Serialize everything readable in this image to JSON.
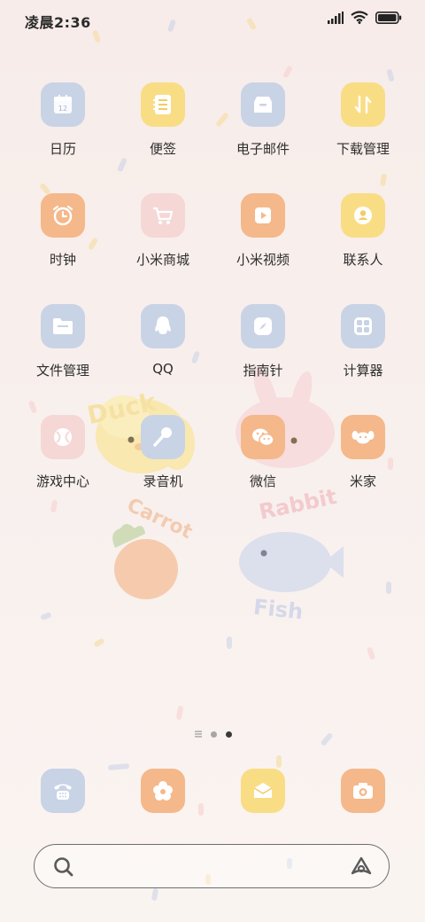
{
  "status_bar": {
    "time": "凌晨2:36"
  },
  "wallpaper": {
    "texts": [
      "Duck",
      "Rabbit",
      "Carrot",
      "Fish"
    ]
  },
  "apps": [
    {
      "label": "日历",
      "icon": "calendar-icon",
      "color": "#c9d3e6",
      "date": "12"
    },
    {
      "label": "便签",
      "icon": "notes-icon",
      "color": "#f9dd85"
    },
    {
      "label": "电子邮件",
      "icon": "email-inbox-icon",
      "color": "#c9d3e6"
    },
    {
      "label": "下载管理",
      "icon": "download-arrows-icon",
      "color": "#f9dd85"
    },
    {
      "label": "时钟",
      "icon": "alarm-clock-icon",
      "color": "#f4b88a"
    },
    {
      "label": "小米商城",
      "icon": "shopping-cart-icon",
      "color": "#f5d7d6"
    },
    {
      "label": "小米视频",
      "icon": "video-play-icon",
      "color": "#f4b88a"
    },
    {
      "label": "联系人",
      "icon": "contact-person-icon",
      "color": "#f9dd85"
    },
    {
      "label": "文件管理",
      "icon": "folder-icon",
      "color": "#c9d3e6"
    },
    {
      "label": "QQ",
      "icon": "penguin-icon",
      "color": "#c9d3e6"
    },
    {
      "label": "指南针",
      "icon": "compass-icon",
      "color": "#c9d3e6"
    },
    {
      "label": "计算器",
      "icon": "calculator-icon",
      "color": "#c9d3e6"
    },
    {
      "label": "游戏中心",
      "icon": "ball-icon",
      "color": "#f5d7d6"
    },
    {
      "label": "录音机",
      "icon": "microphone-icon",
      "color": "#c9d3e6"
    },
    {
      "label": "微信",
      "icon": "wechat-icon",
      "color": "#f4b88a"
    },
    {
      "label": "米家",
      "icon": "mijia-dog-icon",
      "color": "#f4b88a"
    }
  ],
  "dock": [
    {
      "icon": "phone-icon",
      "color": "#c9d3e6"
    },
    {
      "icon": "flower-gallery-icon",
      "color": "#f4b88a"
    },
    {
      "icon": "message-envelope-icon",
      "color": "#f9dd85"
    },
    {
      "icon": "camera-icon",
      "color": "#f4b88a"
    }
  ],
  "page_indicator": {
    "pages": 3,
    "current": 3
  },
  "search": {
    "placeholder": ""
  }
}
